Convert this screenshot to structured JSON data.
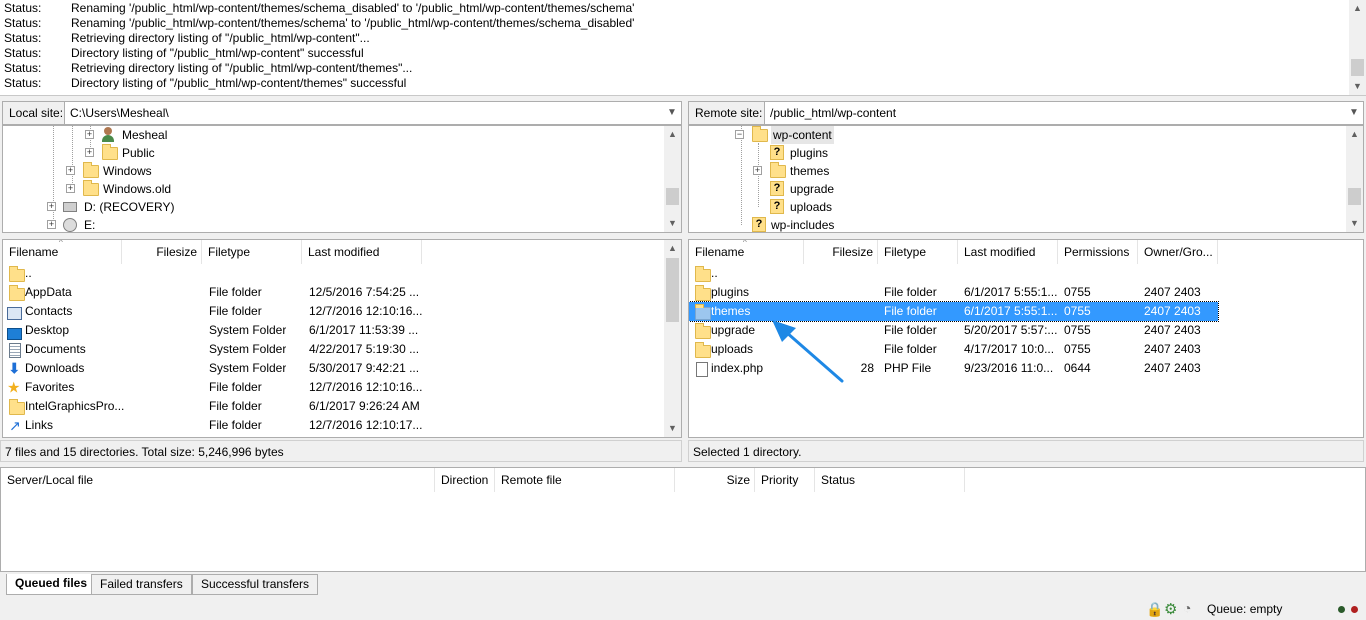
{
  "log": {
    "lines": [
      {
        "label": "Status:",
        "text": "Renaming '/public_html/wp-content/themes/schema_disabled' to '/public_html/wp-content/themes/schema'"
      },
      {
        "label": "Status:",
        "text": "Renaming '/public_html/wp-content/themes/schema' to '/public_html/wp-content/themes/schema_disabled'"
      },
      {
        "label": "Status:",
        "text": "Retrieving directory listing of \"/public_html/wp-content\"..."
      },
      {
        "label": "Status:",
        "text": "Directory listing of \"/public_html/wp-content\" successful"
      },
      {
        "label": "Status:",
        "text": "Retrieving directory listing of \"/public_html/wp-content/themes\"..."
      },
      {
        "label": "Status:",
        "text": "Directory listing of \"/public_html/wp-content/themes\" successful"
      }
    ]
  },
  "local": {
    "site_label": "Local site:",
    "site_path": "C:\\Users\\Mesheal\\",
    "tree": [
      {
        "label": "Mesheal",
        "icon": "user-icon"
      },
      {
        "label": "Public",
        "icon": "folder-icon"
      },
      {
        "label": "Windows",
        "icon": "folder-icon"
      },
      {
        "label": "Windows.old",
        "icon": "folder-icon"
      },
      {
        "label": "D: (RECOVERY)",
        "icon": "drive-icon"
      },
      {
        "label": "E:",
        "icon": "cd-drive-icon"
      }
    ],
    "columns": [
      "Filename",
      "Filesize",
      "Filetype",
      "Last modified"
    ],
    "files": [
      {
        "name": "..",
        "size": "",
        "type": "",
        "modified": "",
        "icon": "folder-icon"
      },
      {
        "name": "AppData",
        "size": "",
        "type": "File folder",
        "modified": "12/5/2016 7:54:25 ...",
        "icon": "folder-icon"
      },
      {
        "name": "Contacts",
        "size": "",
        "type": "File folder",
        "modified": "12/7/2016 12:10:16...",
        "icon": "contacts-icon"
      },
      {
        "name": "Desktop",
        "size": "",
        "type": "System Folder",
        "modified": "6/1/2017 11:53:39 ...",
        "icon": "desktop-icon"
      },
      {
        "name": "Documents",
        "size": "",
        "type": "System Folder",
        "modified": "4/22/2017 5:19:30 ...",
        "icon": "documents-icon"
      },
      {
        "name": "Downloads",
        "size": "",
        "type": "System Folder",
        "modified": "5/30/2017 9:42:21 ...",
        "icon": "download-icon"
      },
      {
        "name": "Favorites",
        "size": "",
        "type": "File folder",
        "modified": "12/7/2016 12:10:16...",
        "icon": "star-icon"
      },
      {
        "name": "IntelGraphicsPro...",
        "size": "",
        "type": "File folder",
        "modified": "6/1/2017 9:26:24 AM",
        "icon": "folder-icon"
      },
      {
        "name": "Links",
        "size": "",
        "type": "File folder",
        "modified": "12/7/2016 12:10:17...",
        "icon": "link-icon"
      }
    ],
    "status": "7 files and 15 directories. Total size: 5,246,996 bytes"
  },
  "remote": {
    "site_label": "Remote site:",
    "site_path": "/public_html/wp-content",
    "tree": [
      {
        "label": "wp-content",
        "icon": "folder-icon"
      },
      {
        "label": "plugins",
        "icon": "unknown-folder-icon"
      },
      {
        "label": "themes",
        "icon": "unknown-folder-icon"
      },
      {
        "label": "upgrade",
        "icon": "unknown-folder-icon"
      },
      {
        "label": "uploads",
        "icon": "unknown-folder-icon"
      },
      {
        "label": "wp-includes",
        "icon": "unknown-folder-icon"
      }
    ],
    "columns": [
      "Filename",
      "Filesize",
      "Filetype",
      "Last modified",
      "Permissions",
      "Owner/Gro..."
    ],
    "files": [
      {
        "name": "..",
        "size": "",
        "type": "",
        "modified": "",
        "perms": "",
        "owner": "",
        "icon": "folder-icon"
      },
      {
        "name": "plugins",
        "size": "",
        "type": "File folder",
        "modified": "6/1/2017 5:55:1...",
        "perms": "0755",
        "owner": "2407 2403",
        "icon": "folder-icon"
      },
      {
        "name": "themes",
        "size": "",
        "type": "File folder",
        "modified": "6/1/2017 5:55:1...",
        "perms": "0755",
        "owner": "2407 2403",
        "icon": "folder-icon",
        "selected": true
      },
      {
        "name": "upgrade",
        "size": "",
        "type": "File folder",
        "modified": "5/20/2017 5:57:...",
        "perms": "0755",
        "owner": "2407 2403",
        "icon": "folder-icon"
      },
      {
        "name": "uploads",
        "size": "",
        "type": "File folder",
        "modified": "4/17/2017 10:0...",
        "perms": "0755",
        "owner": "2407 2403",
        "icon": "folder-icon"
      },
      {
        "name": "index.php",
        "size": "28",
        "type": "PHP File",
        "modified": "9/23/2016 11:0...",
        "perms": "0644",
        "owner": "2407 2403",
        "icon": "file-icon"
      }
    ],
    "status": "Selected 1 directory."
  },
  "queue": {
    "columns": [
      "Server/Local file",
      "Direction",
      "Remote file",
      "Size",
      "Priority",
      "Status"
    ],
    "tabs": [
      "Queued files",
      "Failed transfers",
      "Successful transfers"
    ]
  },
  "statusbar": {
    "queue_text": "Queue: empty"
  },
  "colors": {
    "selection": "#3399ff",
    "annotation_arrow": "#1e88e5"
  }
}
